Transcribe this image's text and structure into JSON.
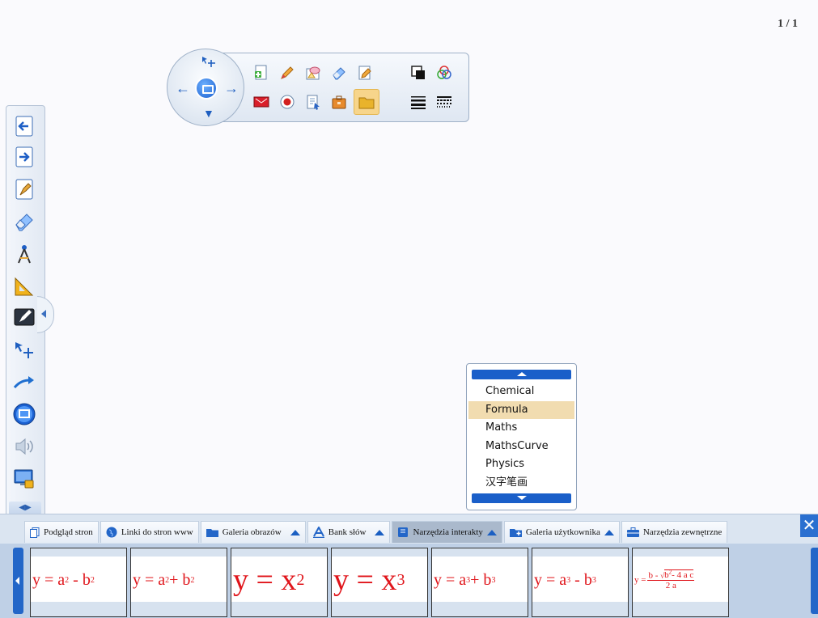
{
  "page_indicator": "1 / 1",
  "dropdown": {
    "items": [
      "Chemical",
      "Formula",
      "Maths",
      "MathsCurve",
      "Physics",
      "汉字笔画"
    ],
    "selected_index": 1
  },
  "tabs": [
    {
      "label": "Podgląd stron",
      "icon": "page-preview-icon"
    },
    {
      "label": "Linki do stron www",
      "icon": "globe-icon"
    },
    {
      "label": "Galeria obrazów",
      "icon": "folder-icon"
    },
    {
      "label": "Bank słów",
      "icon": "letter-a-icon"
    },
    {
      "label": "Narzędzia interakty",
      "icon": "book-icon"
    },
    {
      "label": "Galeria użytkownika",
      "icon": "user-gallery-icon"
    },
    {
      "label": "Narzędzia zewnętrzne",
      "icon": "toolbox-icon"
    }
  ],
  "formulas": [
    "y = a² - b²",
    "y = a² + b²",
    "y = x²",
    "y = x³",
    "y = a³ + b³",
    "y = a³ - b³",
    "y = (b - √(b² - 4ac)) / 2a"
  ],
  "colors": {
    "accent": "#2366c8",
    "selected": "#f1dcb0",
    "formula": "#e0141a"
  }
}
